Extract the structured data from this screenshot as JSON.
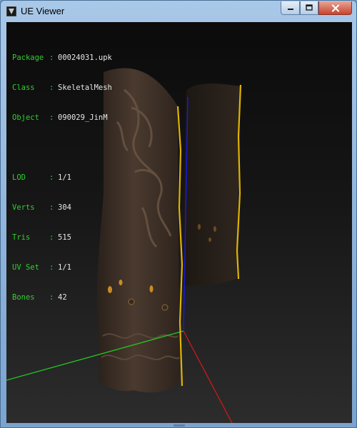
{
  "window": {
    "title": "UE Viewer"
  },
  "info": {
    "package_label": "Package",
    "package_value": "00024031.upk",
    "class_label": "Class",
    "class_value": "SkeletalMesh",
    "object_label": "Object",
    "object_value": "090029_JinM",
    "lod_label": "LOD",
    "lod_value": "1/1",
    "verts_label": "Verts",
    "verts_value": "304",
    "tris_label": "Tris",
    "tris_value": "515",
    "uvset_label": "UV Set",
    "uvset_value": "1/1",
    "bones_label": "Bones",
    "bones_value": "42"
  },
  "colors": {
    "label": "#2ed12e",
    "value": "#e6e6e6",
    "axis_x": "#d01818",
    "axis_y": "#22c822",
    "axis_z": "#1a1ad8",
    "bone": "#e0b400",
    "mesh": "#3b2d24"
  },
  "icons": {
    "app": "ue-viewer-app-icon",
    "minimize": "minimize-icon",
    "maximize": "maximize-icon",
    "close": "close-icon"
  }
}
